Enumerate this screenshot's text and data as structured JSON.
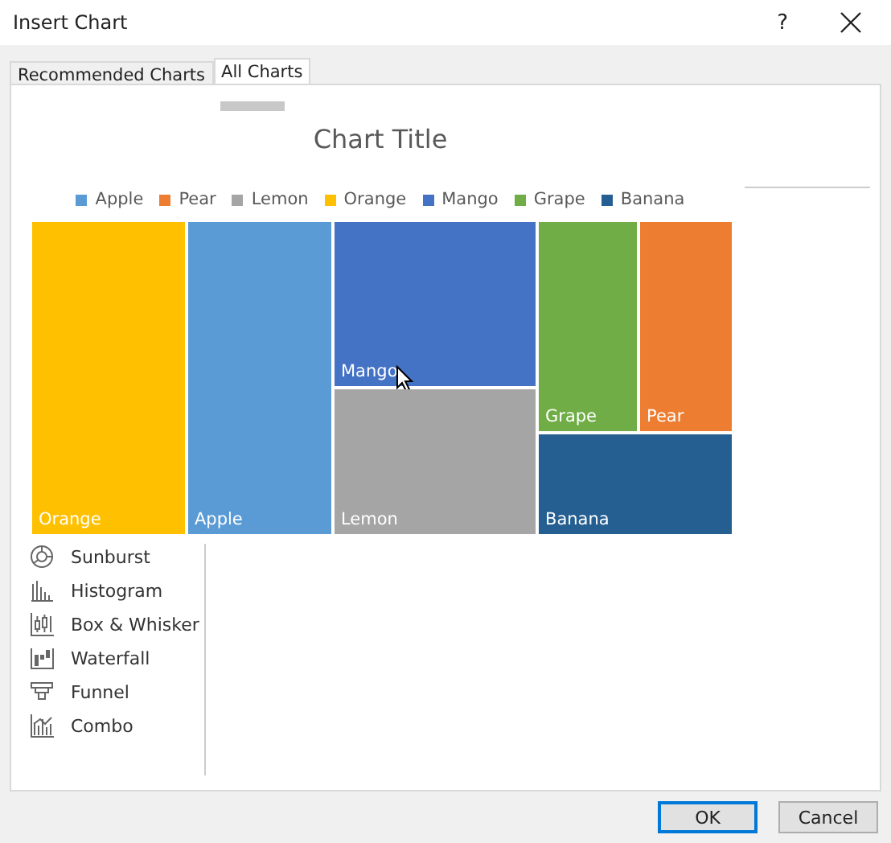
{
  "window": {
    "title": "Insert Chart",
    "help": "?"
  },
  "tabs": [
    {
      "label": "Recommended Charts",
      "selected": false
    },
    {
      "label": "All Charts",
      "selected": true
    }
  ],
  "chart_types": [
    {
      "label": "Sunburst",
      "kind": "sunburst"
    },
    {
      "label": "Histogram",
      "kind": "histogram"
    },
    {
      "label": "Box & Whisker",
      "kind": "boxwhisker"
    },
    {
      "label": "Waterfall",
      "kind": "waterfall"
    },
    {
      "label": "Funnel",
      "kind": "funnel"
    },
    {
      "label": "Combo",
      "kind": "combo"
    }
  ],
  "preview": {
    "title": "Chart Title",
    "legend": [
      {
        "label": "Apple",
        "color": "#5b9bd5"
      },
      {
        "label": "Pear",
        "color": "#ed7d31"
      },
      {
        "label": "Lemon",
        "color": "#a5a5a5"
      },
      {
        "label": "Orange",
        "color": "#ffc000"
      },
      {
        "label": "Mango",
        "color": "#4472c4"
      },
      {
        "label": "Grape",
        "color": "#70ad47"
      },
      {
        "label": "Banana",
        "color": "#255e91"
      }
    ],
    "columns": [
      {
        "kind": "single",
        "tiles": [
          {
            "label": "Orange",
            "color": "#ffc000"
          }
        ]
      },
      {
        "kind": "single",
        "tiles": [
          {
            "label": "Apple",
            "color": "#5b9bd5"
          }
        ]
      },
      {
        "kind": "stack",
        "tiles": [
          {
            "label": "Mango",
            "color": "#4472c4"
          },
          {
            "label": "Lemon",
            "color": "#a5a5a5"
          }
        ]
      },
      {
        "kind": "split",
        "top": [
          {
            "label": "Grape",
            "color": "#70ad47"
          },
          {
            "label": "Pear",
            "color": "#ed7d31"
          }
        ],
        "bottom": [
          {
            "label": "Banana",
            "color": "#255e91"
          }
        ]
      }
    ]
  },
  "buttons": [
    {
      "label": "OK",
      "default": true
    },
    {
      "label": "Cancel",
      "default": false
    }
  ]
}
